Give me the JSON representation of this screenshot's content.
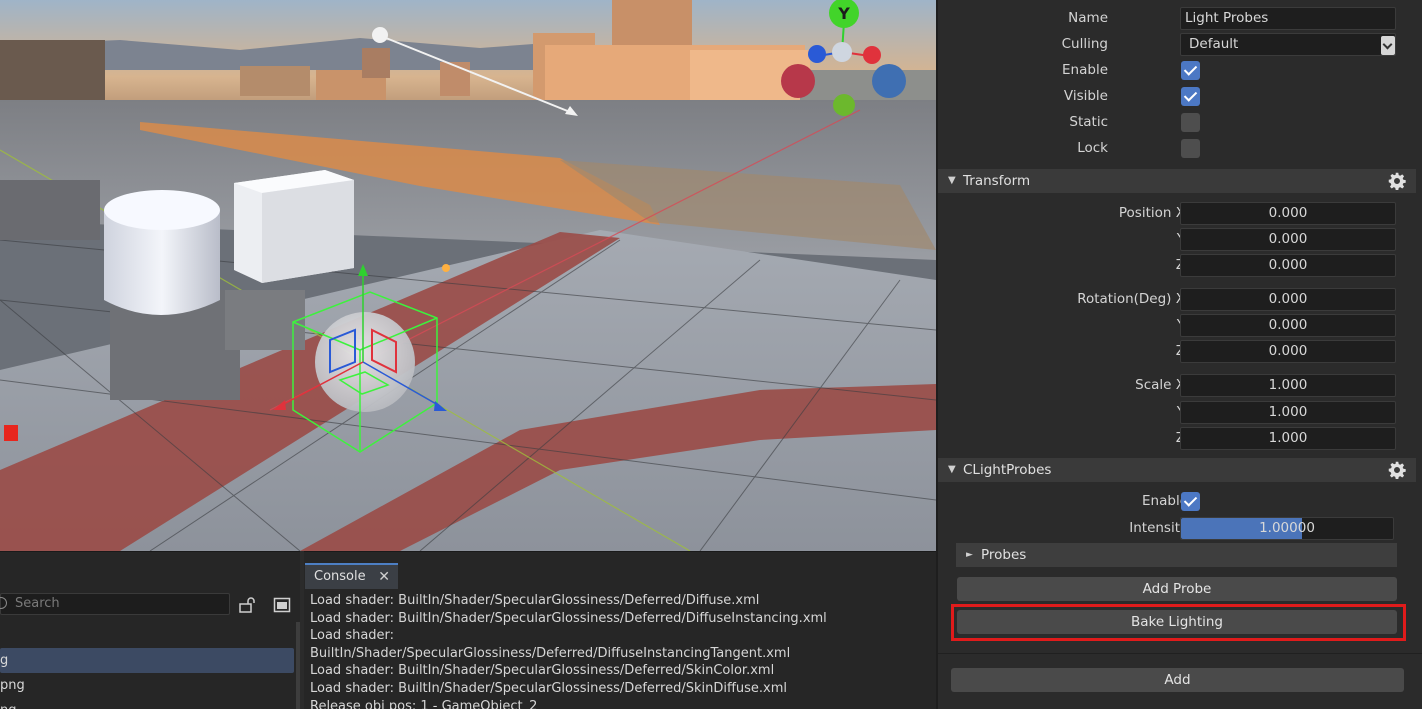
{
  "inspector": {
    "name_label": "Name",
    "name_value": "Light Probes",
    "culling_label": "Culling",
    "culling_value": "Default",
    "enable_label": "Enable",
    "visible_label": "Visible",
    "static_label": "Static",
    "lock_label": "Lock",
    "enable_checked": true,
    "visible_checked": true,
    "static_checked": false,
    "lock_checked": false,
    "transform": {
      "title": "Transform",
      "position_label": "Position X",
      "rotation_label": "Rotation(Deg) X",
      "scale_label": "Scale X",
      "y_label": "Y",
      "z_label": "Z",
      "position": [
        "0.000",
        "0.000",
        "0.000"
      ],
      "rotation": [
        "0.000",
        "0.000",
        "0.000"
      ],
      "scale": [
        "1.000",
        "1.000",
        "1.000"
      ]
    },
    "light_probes": {
      "title": "CLightProbes",
      "enable_label": "Enable",
      "enable_checked": true,
      "intensity_label": "Intensity",
      "intensity_value": "1.00000",
      "intensity_fraction": 0.57,
      "probes_label": "Probes",
      "add_probe_label": "Add Probe",
      "bake_lighting_label": "Bake Lighting"
    },
    "add_label": "Add"
  },
  "console": {
    "tab_label": "Console",
    "lines": [
      "Load shader: BuiltIn/Shader/SpecularGlossiness/Deferred/Diffuse.xml",
      "Load shader: BuiltIn/Shader/SpecularGlossiness/Deferred/DiffuseInstancing.xml",
      "Load shader:",
      "BuiltIn/Shader/SpecularGlossiness/Deferred/DiffuseInstancingTangent.xml",
      "Load shader: BuiltIn/Shader/SpecularGlossiness/Deferred/SkinColor.xml",
      "Load shader: BuiltIn/Shader/SpecularGlossiness/Deferred/SkinDiffuse.xml",
      "Release obj pos: 1 - GameObject_2"
    ]
  },
  "assets": {
    "search_placeholder": "Search",
    "items": [
      "g",
      "png",
      "ng"
    ]
  },
  "viewport": {
    "gizmo_axis_label": "Y",
    "colors": {
      "x_axis": "#e0323c",
      "y_axis": "#2fd12f",
      "z_axis": "#2a5ad6",
      "selection": "#3df23d",
      "highlight": "#e01b1b",
      "accent": "#4c78c4"
    }
  }
}
